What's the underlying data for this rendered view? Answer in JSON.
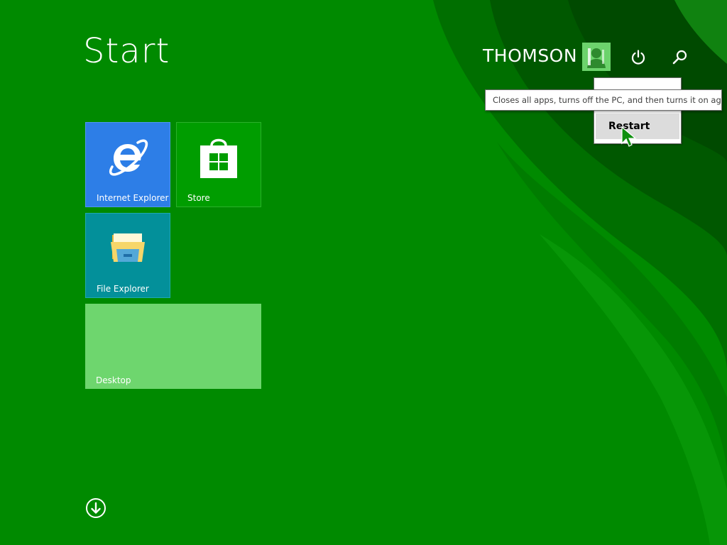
{
  "screen": {
    "title": "Start"
  },
  "user": {
    "name": "THOMSON"
  },
  "icons": {
    "avatar": "user-avatar-icon",
    "power": "power-icon",
    "search": "search-icon",
    "all_apps": "arrow-down-circle-icon"
  },
  "power_menu": {
    "items": [
      {
        "label": ""
      },
      {
        "label": "Restart"
      }
    ],
    "tooltip": "Closes all apps, turns off the PC, and then turns it on again."
  },
  "tiles": [
    {
      "label": "Internet Explorer",
      "icon": "internet-explorer-icon",
      "color": "#2d7ee7"
    },
    {
      "label": "Store",
      "icon": "store-bag-icon",
      "color": "#009d00"
    },
    {
      "label": "File Explorer",
      "icon": "folder-icon",
      "color": "#03909a"
    },
    {
      "label": "Desktop",
      "icon": "",
      "color": "#6ed66e"
    }
  ],
  "colors": {
    "background": "#008a00",
    "accent": "#6cd36c"
  }
}
